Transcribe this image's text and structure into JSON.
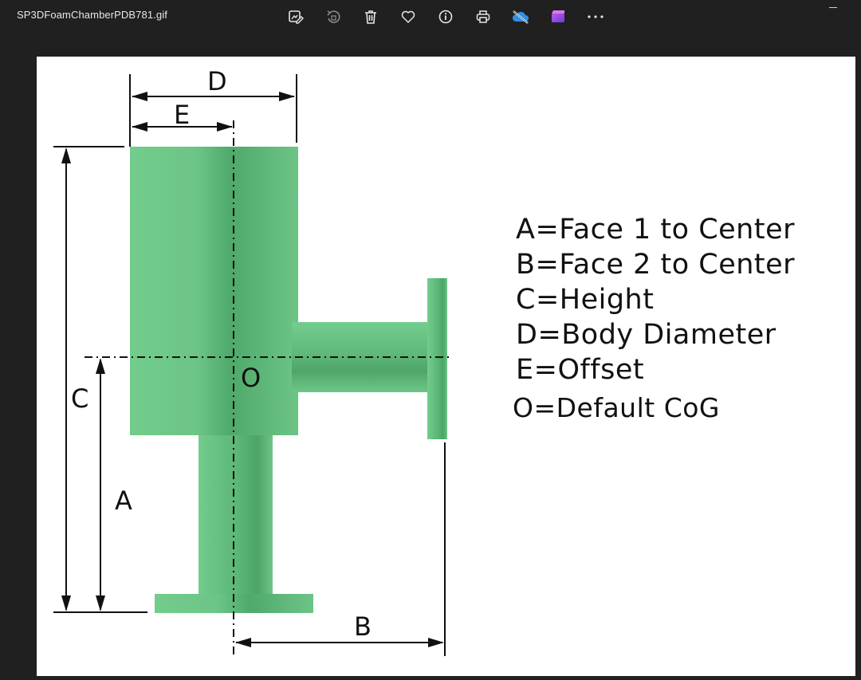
{
  "titlebar": {
    "filename": "SP3DFoamChamberPDB781.gif"
  },
  "toolbar": {
    "items": [
      {
        "name": "edit-image",
        "icon": "edit-image-icon"
      },
      {
        "name": "rotate",
        "icon": "rotate-icon"
      },
      {
        "name": "delete",
        "icon": "trash-icon"
      },
      {
        "name": "favorite",
        "icon": "heart-icon"
      },
      {
        "name": "info",
        "icon": "info-icon"
      },
      {
        "name": "print",
        "icon": "print-icon"
      },
      {
        "name": "onedrive-sync",
        "icon": "cloud-off-icon"
      },
      {
        "name": "clipchamp",
        "icon": "clipchamp-icon"
      },
      {
        "name": "more",
        "icon": "more-icon"
      }
    ]
  },
  "diagram": {
    "labels": {
      "d": "D",
      "e": "E",
      "c": "C",
      "a": "A",
      "b": "B",
      "o": "O"
    },
    "legend": [
      "A=Face 1 to Center",
      "B=Face 2 to Center",
      "C=Height",
      "D=Body Diameter",
      "E=Offset",
      "O=Default CoG"
    ],
    "colors": {
      "body_green": "#6fc98a",
      "body_green_dark": "#4fa86a",
      "line": "#111111"
    }
  }
}
